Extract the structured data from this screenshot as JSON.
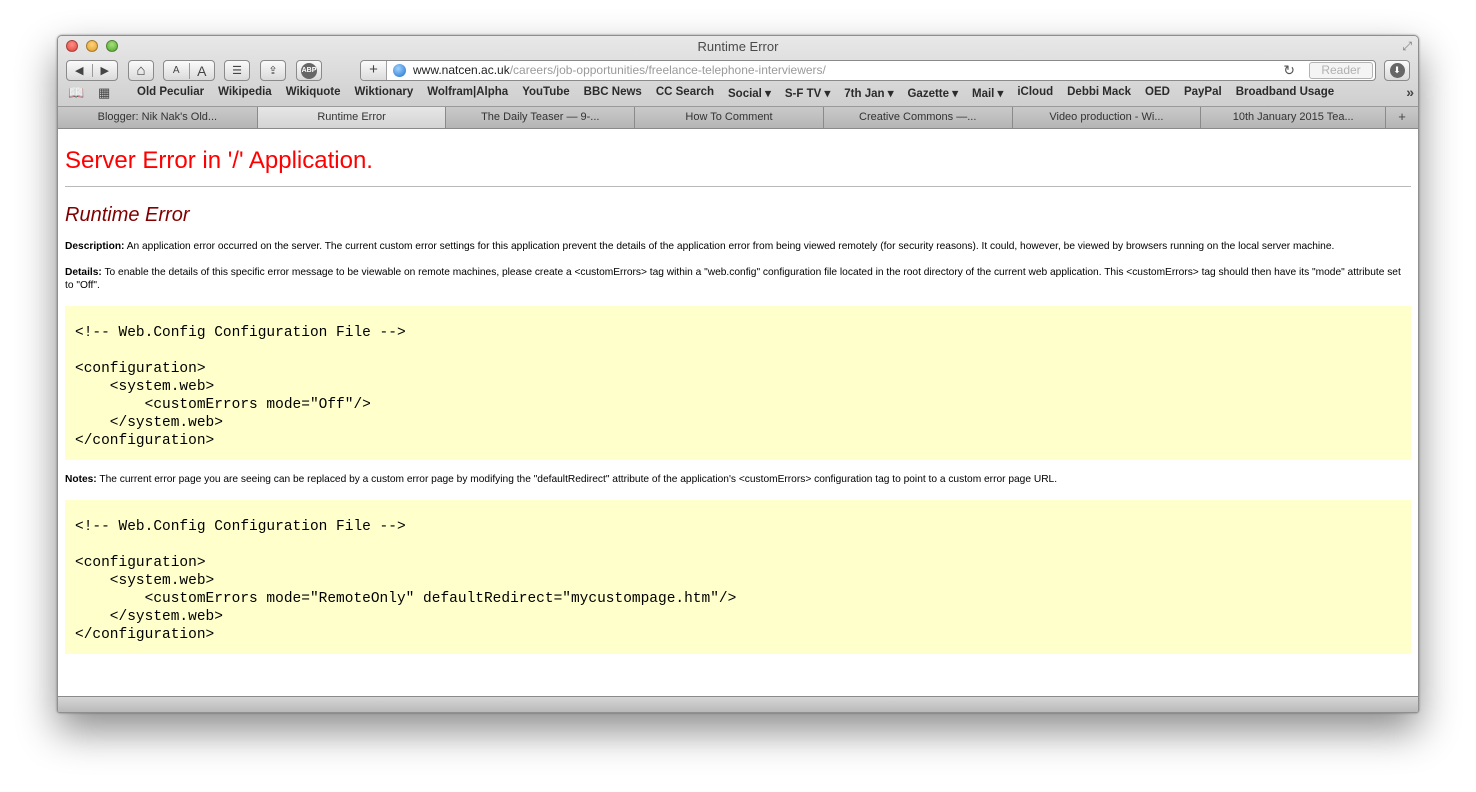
{
  "window": {
    "title": "Runtime Error"
  },
  "toolbar": {
    "back_label": "◀",
    "forward_label": "▶",
    "home_icon": "⌂",
    "font_small": "A",
    "font_large": "A",
    "reading_list_icon": "☰",
    "share_icon": "⇪",
    "adblock_label": "ABP",
    "add_label": "+",
    "url_domain": "www.natcen.ac.uk",
    "url_path": "/careers/job-opportunities/freelance-telephone-interviewers/",
    "reload_icon": "↻",
    "reader_label": "Reader",
    "download_icon": "⬇"
  },
  "bookmarks": {
    "book_icon": "📖",
    "grid_icon": "▦",
    "items": [
      "Old Peculiar",
      "Wikipedia",
      "Wikiquote",
      "Wiktionary",
      "Wolfram|Alpha",
      "YouTube",
      "BBC News",
      "CC Search",
      "Social ▾",
      "S-F TV ▾",
      "7th Jan ▾",
      "Gazette ▾",
      "Mail ▾",
      "iCloud",
      "Debbi Mack",
      "OED",
      "PayPal",
      "Broadband Usage"
    ],
    "more_label": "»"
  },
  "tabs": [
    "Blogger: Nik Nak's Old...",
    "Runtime Error",
    "The Daily Teaser — 9-...",
    "How To Comment",
    "Creative Commons —...",
    "Video production - Wi...",
    "10th January 2015 Tea..."
  ],
  "tab_add_label": "+",
  "page": {
    "heading": "Server Error in '/' Application.",
    "subheading": "Runtime Error",
    "description_label": "Description:",
    "description_text": " An application error occurred on the server. The current custom error settings for this application prevent the details of the application error from being viewed remotely (for security reasons). It could, however, be viewed by browsers running on the local server machine.",
    "details_label": "Details:",
    "details_text": " To enable the details of this specific error message to be viewable on remote machines, please create a <customErrors> tag within a \"web.config\" configuration file located in the root directory of the current web application. This <customErrors> tag should then have its \"mode\" attribute set to \"Off\".",
    "code1": "<!-- Web.Config Configuration File -->\n\n<configuration>\n    <system.web>\n        <customErrors mode=\"Off\"/>\n    </system.web>\n</configuration>",
    "notes_label": "Notes:",
    "notes_text": " The current error page you are seeing can be replaced by a custom error page by modifying the \"defaultRedirect\" attribute of the application's <customErrors> configuration tag to point to a custom error page URL.",
    "code2": "<!-- Web.Config Configuration File -->\n\n<configuration>\n    <system.web>\n        <customErrors mode=\"RemoteOnly\" defaultRedirect=\"mycustompage.htm\"/>\n    </system.web>\n</configuration>"
  }
}
